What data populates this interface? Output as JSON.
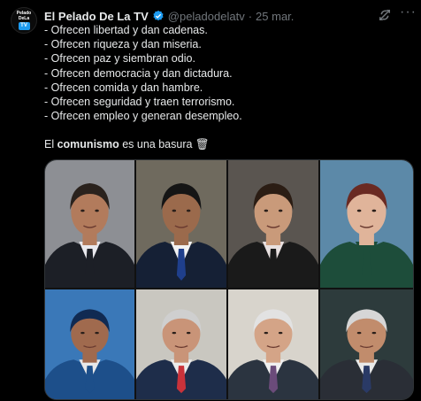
{
  "tweet": {
    "avatar_text": {
      "line1": "Pelado",
      "line2": "DeLa",
      "badge": "TV"
    },
    "author_name": "El Pelado De La TV",
    "handle": "@peladodelatv",
    "separator": "·",
    "date": "25 mar.",
    "lines": [
      "- Ofrecen libertad y dan cadenas.",
      "- Ofrecen riqueza y dan miseria.",
      "- Ofrecen paz y siembran odio.",
      "- Ofrecen democracia y dan dictadura.",
      "- Ofrecen comida y dan hambre.",
      "- Ofrecen seguridad y traen terrorismo.",
      "- Ofrecen empleo y generan desempleo."
    ],
    "closing": {
      "before": "El ",
      "bold": "comunismo",
      "after": " es una basura ",
      "emoji": "🗑"
    },
    "more_glyph": "···"
  },
  "colors": {
    "background": "#000000",
    "text": "#e7e9ea",
    "muted": "#71767b",
    "accent": "#1d9bf0"
  },
  "icons": [
    "verified-badge-icon",
    "grok-icon",
    "more-icon",
    "wastebasket-icon"
  ],
  "media": {
    "photos": [
      {
        "id": "photo-1",
        "bg": "#8d8f94",
        "suit": "#1c1f26",
        "skin": "#b27b5c",
        "hair": "#2a221d",
        "tie": "#1c1f26",
        "shirt": "#e9e9ee"
      },
      {
        "id": "photo-2",
        "bg": "#6f6a5e",
        "suit": "#152035",
        "skin": "#9b6a4c",
        "hair": "#151515",
        "tie": "#1f3f8c",
        "shirt": "#f2f2f2"
      },
      {
        "id": "photo-3",
        "bg": "#5a5550",
        "suit": "#1a1a1a",
        "skin": "#c99a7a",
        "hair": "#2b1d14",
        "tie": "#1a1a1a",
        "shirt": "#e8e0e0"
      },
      {
        "id": "photo-4",
        "bg": "#5c89a8",
        "suit": "#1d4d3a",
        "skin": "#e0b49a",
        "hair": "#6a2a22",
        "tie": "#1d4d3a",
        "shirt": "#1d4d3a"
      },
      {
        "id": "photo-5",
        "bg": "#3a78b8",
        "suit": "#1d4f8a",
        "skin": "#a06a4e",
        "hair": "#102a52",
        "tie": "#1d4f8a",
        "shirt": "#e8e8e8"
      },
      {
        "id": "photo-6",
        "bg": "#c9c7c0",
        "suit": "#1e2d4a",
        "skin": "#c99478",
        "hair": "#cfcfcf",
        "tie": "#c9323a",
        "shirt": "#ececec"
      },
      {
        "id": "photo-7",
        "bg": "#d8d4cc",
        "suit": "#2b3440",
        "skin": "#d4a487",
        "hair": "#e2e2e2",
        "tie": "#6b4b7a",
        "shirt": "#f0f0f0"
      },
      {
        "id": "photo-8",
        "bg": "#2d3b3c",
        "suit": "#2a2e36",
        "skin": "#c18c6c",
        "hair": "#d6d6d6",
        "tie": "#2a3a66",
        "shirt": "#eaeaea"
      }
    ]
  }
}
